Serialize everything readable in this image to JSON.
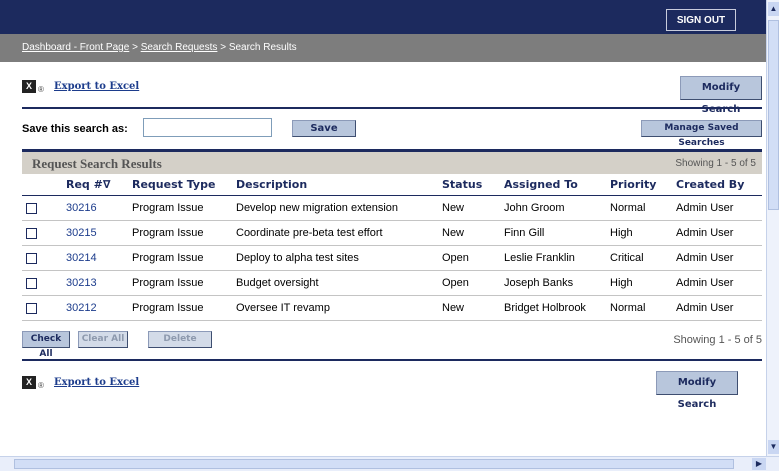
{
  "header": {
    "sign_out": "SIGN OUT"
  },
  "breadcrumb": {
    "item1": "Dashboard - Front Page",
    "sep": ">",
    "item2": "Search Requests",
    "current": "Search Results"
  },
  "export": {
    "label": "Export to Excel",
    "icon": "excel-icon",
    "small": "®"
  },
  "modify_search": "Modify Search",
  "save_search": {
    "label": "Save this search as:",
    "value": "",
    "placeholder": "",
    "save_button": "Save",
    "manage_button": "Manage Saved Searches"
  },
  "results": {
    "title": "Request Search Results",
    "showing": "Showing 1 - 5 of 5",
    "columns": [
      "Req #∇",
      "Request Type",
      "Description",
      "Status",
      "Assigned To",
      "Priority",
      "Created By"
    ],
    "rows": [
      {
        "req": "30216",
        "type": "Program Issue",
        "desc": "Develop new migration extension",
        "status": "New",
        "assigned": "John Groom",
        "priority": "Normal",
        "created": "Admin User"
      },
      {
        "req": "30215",
        "type": "Program Issue",
        "desc": "Coordinate pre-beta test effort",
        "status": "New",
        "assigned": "Finn Gill",
        "priority": "High",
        "created": "Admin User"
      },
      {
        "req": "30214",
        "type": "Program Issue",
        "desc": "Deploy to alpha test sites",
        "status": "Open",
        "assigned": "Leslie Franklin",
        "priority": "Critical",
        "created": "Admin User"
      },
      {
        "req": "30213",
        "type": "Program Issue",
        "desc": "Budget oversight",
        "status": "Open",
        "assigned": "Joseph Banks",
        "priority": "High",
        "created": "Admin User"
      },
      {
        "req": "30212",
        "type": "Program Issue",
        "desc": "Oversee IT revamp",
        "status": "New",
        "assigned": "Bridget Holbrook",
        "priority": "Normal",
        "created": "Admin User"
      }
    ]
  },
  "actions": {
    "check_all": "Check All",
    "clear_all": "Clear All",
    "delete": "Delete"
  },
  "bottom_showing": "Showing 1 - 5 of 5",
  "colors": {
    "navy": "#1c2a5e",
    "gray_bar": "#7d7d7d",
    "button": "#b8c6dc"
  }
}
